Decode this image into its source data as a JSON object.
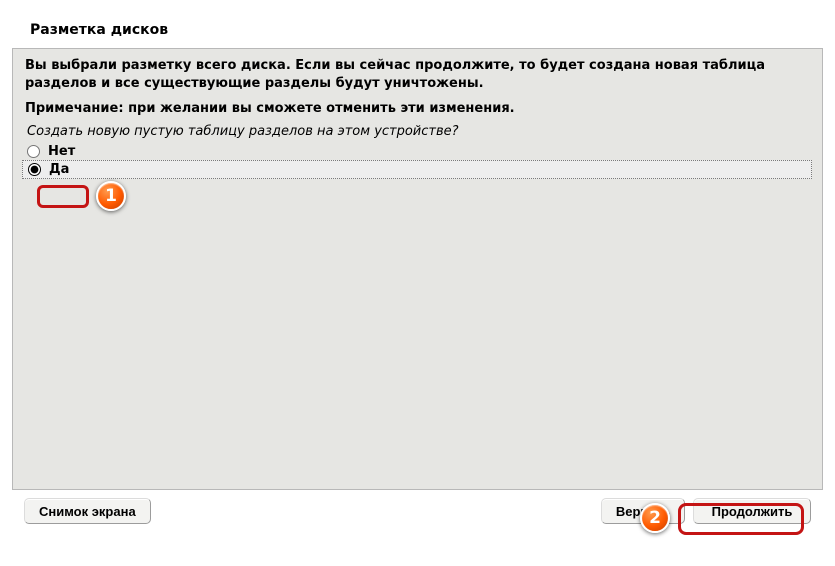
{
  "title": "Разметка дисков",
  "warning_text": "Вы выбрали разметку всего диска. Если вы сейчас продолжите, то будет создана новая таблица разделов и все существующие разделы будут уничтожены.",
  "note_text": "Примечание: при желании вы сможете отменить эти изменения.",
  "question": "Создать новую пустую таблицу разделов на этом устройстве?",
  "options": {
    "no": "Нет",
    "yes": "Да"
  },
  "buttons": {
    "screenshot": "Снимок экрана",
    "back": "Вернуть",
    "continue": "Продолжить"
  },
  "markers": {
    "one": "1",
    "two": "2"
  }
}
